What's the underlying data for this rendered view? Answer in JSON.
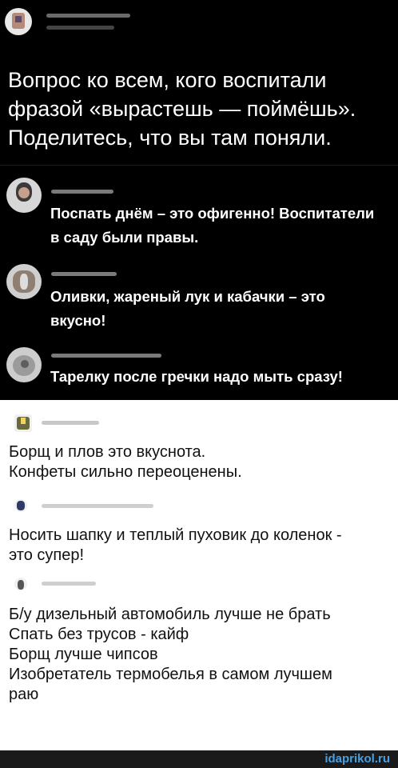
{
  "post": {
    "text": "Вопрос ко всем, кого воспитали фразой «вырастешь — поймёшь». Поделитесь, что вы там поняли."
  },
  "comments": [
    {
      "text": "Поспать днём – это офигенно! Воспитатели в саду были правы."
    },
    {
      "text": "Оливки, жареный лук и кабачки – это вкусно!"
    },
    {
      "text": "Тарелку после гречки надо мыть сразу!"
    }
  ],
  "light_comments": [
    {
      "text": "Борщ и плов это вкуснота.\nКонфеты сильно переоценены."
    },
    {
      "text": "Носить шапку и теплый пуховик до коленок - это супер!"
    },
    {
      "text": "Б/у дизельный автомобиль лучше не брать\nСпать без трусов - кайф\nБорщ лучше чипсов\nИзобретатель термобелья в самом лучшем раю"
    }
  ],
  "watermark": "idaprikol.ru"
}
